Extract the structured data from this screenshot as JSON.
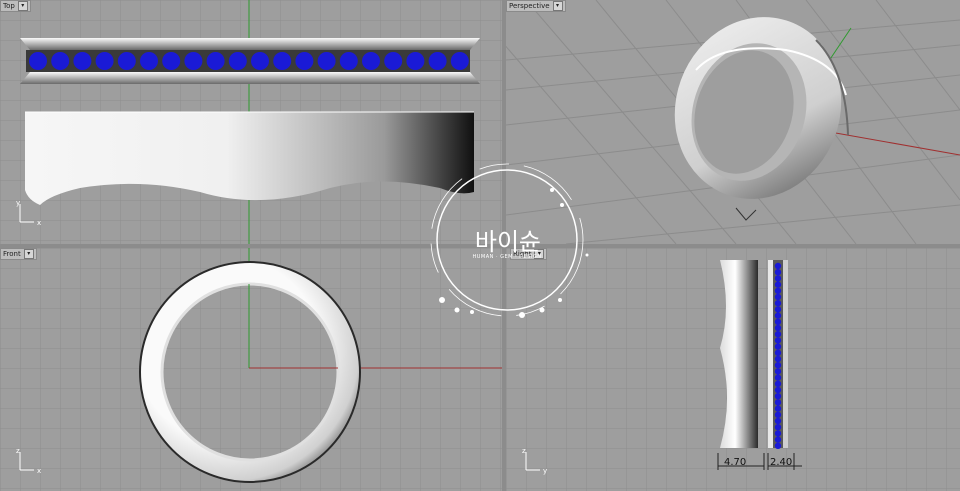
{
  "viewports": {
    "top": {
      "label": "Top"
    },
    "perspective": {
      "label": "Perspective"
    },
    "front": {
      "label": "Front"
    },
    "right": {
      "label": "Right"
    }
  },
  "dimensions": {
    "width_left": "4.70",
    "width_right": "2.40"
  },
  "watermark": {
    "title": "바이슌",
    "subtitle": "HUMAN · GEM · DESIGN"
  },
  "colors": {
    "background": "#9e9e9e",
    "grid": "#8f8f8f",
    "gem": "#1a1ad6",
    "x_axis": "#a03030",
    "y_axis": "#2f9a2f"
  }
}
